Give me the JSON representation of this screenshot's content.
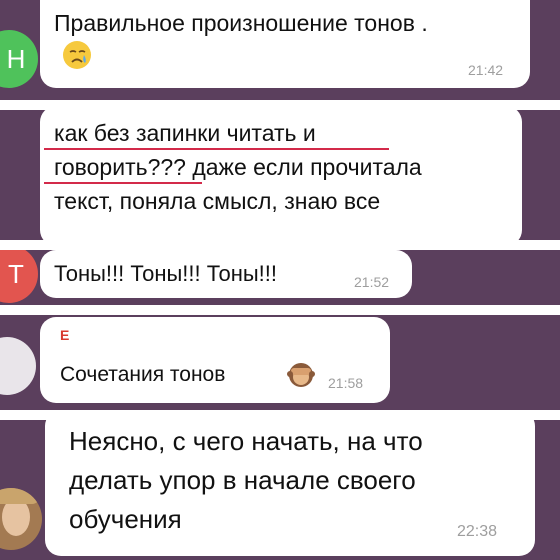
{
  "messages": [
    {
      "text": "Правильное произношение тонов .",
      "time": "21:42",
      "emoji": "crying-face"
    },
    {
      "lines": [
        "как без запинки читать и",
        "говорить??? даже если прочитала",
        "текст, поняла смысл, знаю все"
      ]
    },
    {
      "text": "Тоны!!! Тоны!!! Тоны!!!",
      "time": "21:52"
    },
    {
      "sender": "Е",
      "text": "Сочетания тонов",
      "time": "21:58",
      "emoji": "see-no-evil-monkey"
    },
    {
      "lines": [
        "Неясно, с чего начать, на что",
        "делать упор в начале своего",
        "обучения"
      ],
      "time": "22:38"
    }
  ],
  "avatars": {
    "first_initial": "Н",
    "third_initial": "Т"
  },
  "colors": {
    "background": "#5b3f5d",
    "bubble": "#ffffff",
    "underline": "#d32a4a",
    "time": "#9e9e9e"
  }
}
